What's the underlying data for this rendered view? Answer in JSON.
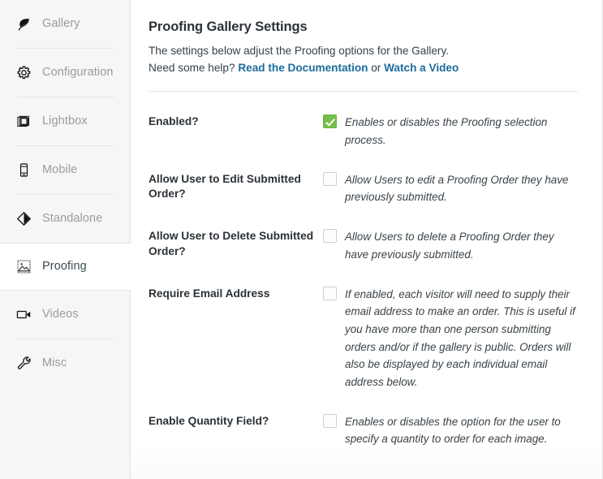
{
  "sidebar": {
    "items": [
      {
        "label": "Gallery",
        "icon": "leaf-icon",
        "active": false
      },
      {
        "label": "Configuration",
        "icon": "gear-icon",
        "active": false
      },
      {
        "label": "Lightbox",
        "icon": "layers-icon",
        "active": false
      },
      {
        "label": "Mobile",
        "icon": "phone-icon",
        "active": false
      },
      {
        "label": "Standalone",
        "icon": "diamond-icon",
        "active": false
      },
      {
        "label": "Proofing",
        "icon": "image-icon",
        "active": true
      },
      {
        "label": "Videos",
        "icon": "video-icon",
        "active": false
      },
      {
        "label": "Misc",
        "icon": "wrench-icon",
        "active": false
      }
    ]
  },
  "main": {
    "title": "Proofing Gallery Settings",
    "description_line1": "The settings below adjust the Proofing options for the Gallery.",
    "description_prefix": "Need some help? ",
    "doc_link": "Read the Documentation",
    "description_separator": " or ",
    "video_link": "Watch a Video",
    "link_color": "#1b6c9c",
    "checked_color": "#74bf4a",
    "settings": [
      {
        "label": "Enabled?",
        "checked": true,
        "description": "Enables or disables the Proofing selection process."
      },
      {
        "label": "Allow User to Edit Submitted Order?",
        "checked": false,
        "description": "Allow Users to edit a Proofing Order they have previously submitted."
      },
      {
        "label": "Allow User to Delete Submitted Order?",
        "checked": false,
        "description": "Allow Users to delete a Proofing Order they have previously submitted."
      },
      {
        "label": "Require Email Address",
        "checked": false,
        "description": "If enabled, each visitor will need to supply their email address to make an order. This is useful if you have more than one person submitting orders and/or if the gallery is public. Orders will also be displayed by each individual email address below."
      },
      {
        "label": "Enable Quantity Field?",
        "checked": false,
        "description": "Enables or disables the option for the user to specify a quantity to order for each image."
      }
    ]
  }
}
